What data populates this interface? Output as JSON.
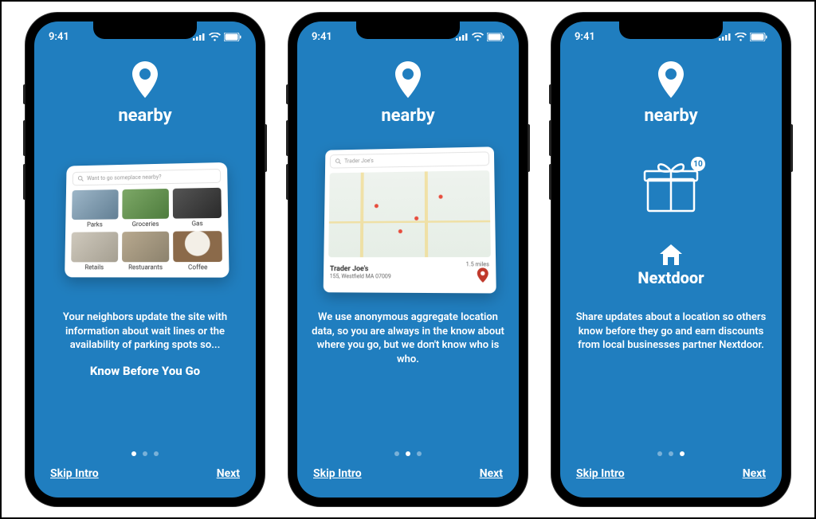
{
  "status": {
    "time": "9:41"
  },
  "brand": "nearby",
  "screens": [
    {
      "search_placeholder": "Want to go someplace nearby?",
      "tiles": [
        "Parks",
        "Groceries",
        "Gas",
        "Retails",
        "Restuarants",
        "Coffee"
      ],
      "desc": "Your neighbors update the site with information about wait lines or the availability of parking spots so...",
      "tagline": "Know Before You Go",
      "skip": "Skip Intro",
      "next": "Next",
      "page_index": 0
    },
    {
      "search_placeholder": "Trader Joe's",
      "result": {
        "name": "Trader Joe's",
        "distance": "1.5 miles",
        "address": "155, Westfield MA 07009"
      },
      "desc": "We use anonymous aggregate location data, so you are always in the know about where you go, but we don't know who is who.",
      "skip": "Skip Intro",
      "next": "Next",
      "page_index": 1
    },
    {
      "badge": "10",
      "partner": "Nextdoor",
      "desc": "Share updates about a location so others know before they go and earn  discounts from local businesses partner Nextdoor.",
      "skip": "Skip Intro",
      "next": "Next",
      "page_index": 2
    }
  ],
  "colors": {
    "primary": "#207ebf"
  }
}
